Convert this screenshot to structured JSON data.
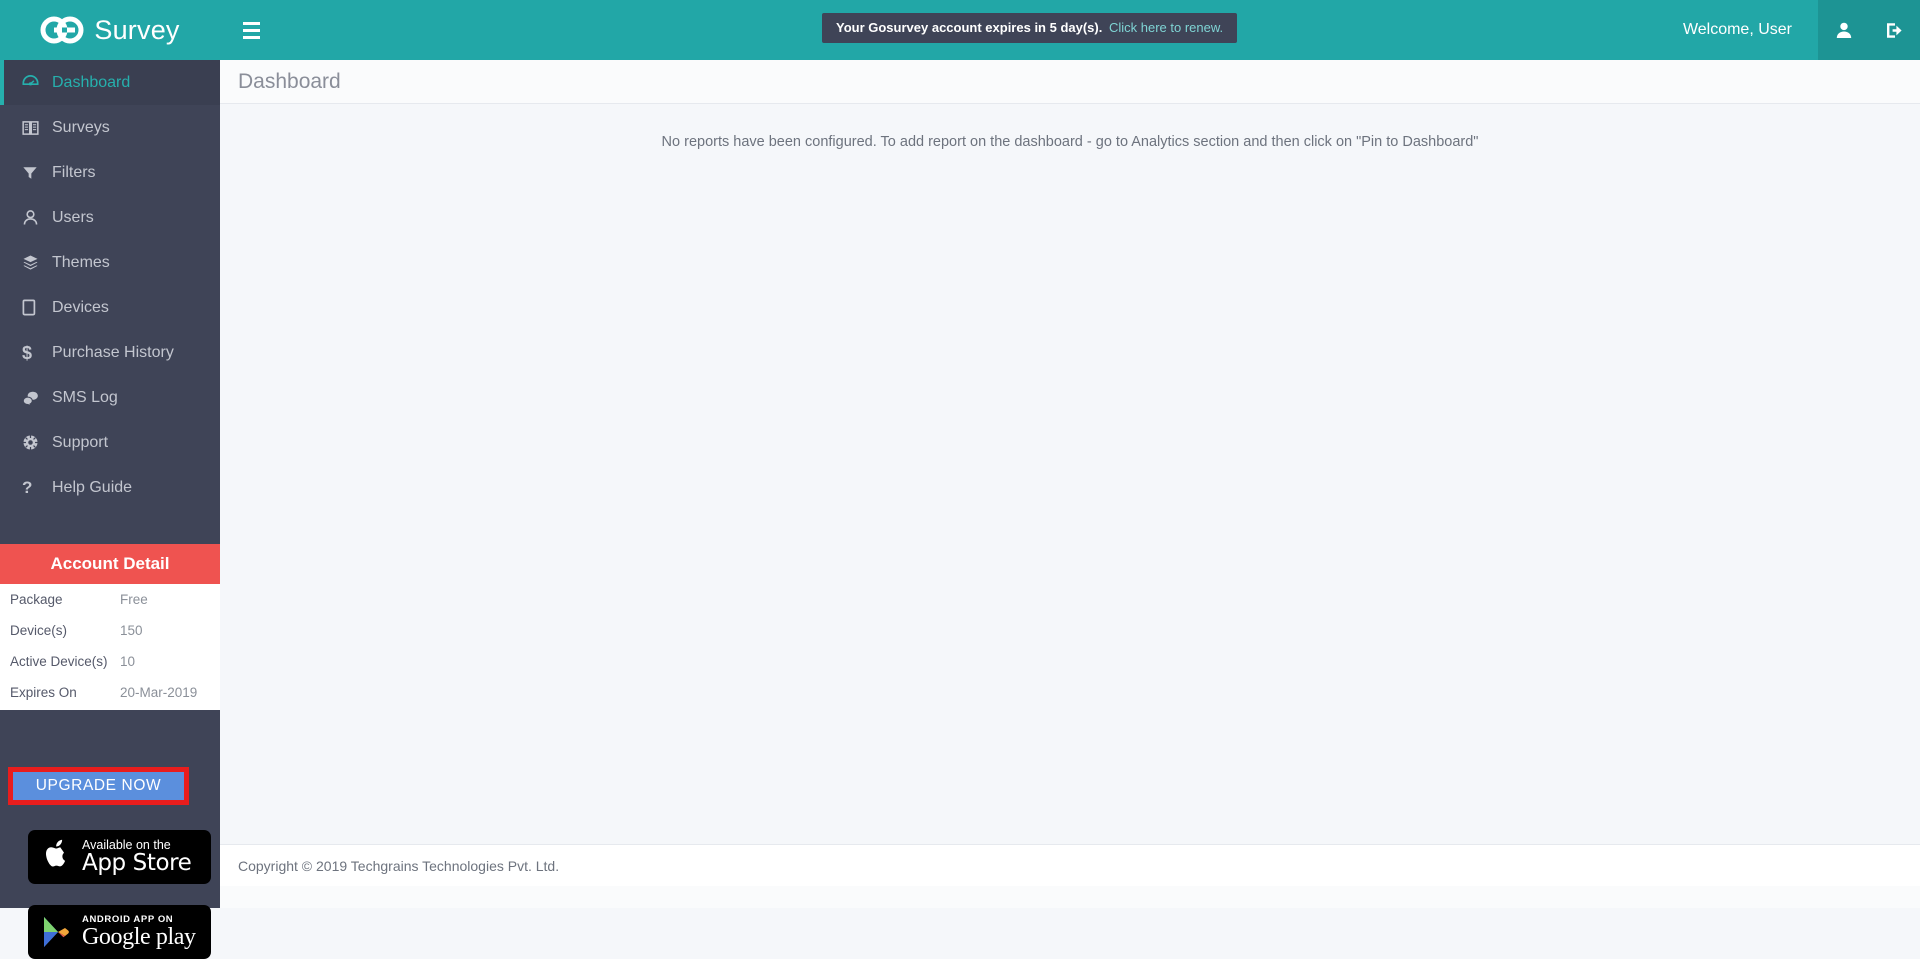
{
  "brand": {
    "text": "Survey",
    "mark_icon": "go-logo-icon"
  },
  "header": {
    "menu_toggle_icon": "hamburger-icon",
    "banner": {
      "message": "Your Gosurvey account expires in 5 day(s).",
      "link": "Click here to renew."
    },
    "welcome": "Welcome, User",
    "profile_icon": "user-icon",
    "logout_icon": "logout-icon",
    "bg_color": "#22a7a7"
  },
  "sidebar": {
    "bg_color": "#3f4457",
    "active_color": "#26b0ad",
    "items": [
      {
        "label": "Dashboard",
        "icon": "dashboard-gauge-icon",
        "active": true
      },
      {
        "label": "Surveys",
        "icon": "book-icon",
        "active": false
      },
      {
        "label": "Filters",
        "icon": "funnel-icon",
        "active": false
      },
      {
        "label": "Users",
        "icon": "user-outline-icon",
        "active": false
      },
      {
        "label": "Themes",
        "icon": "layers-icon",
        "active": false
      },
      {
        "label": "Devices",
        "icon": "tablet-icon",
        "active": false
      },
      {
        "label": "Purchase History",
        "icon": "dollar-icon",
        "active": false
      },
      {
        "label": "SMS Log",
        "icon": "chat-bubbles-icon",
        "active": false
      },
      {
        "label": "Support",
        "icon": "globe-icon",
        "active": false
      },
      {
        "label": "Help Guide",
        "icon": "question-mark-icon",
        "active": false
      }
    ]
  },
  "account_detail": {
    "title": "Account Detail",
    "title_bg": "#ef5350",
    "rows": [
      {
        "key": "Package",
        "value": "Free"
      },
      {
        "key": "Device(s)",
        "value": "150"
      },
      {
        "key": "Active Device(s)",
        "value": "10"
      },
      {
        "key": "Expires On",
        "value": "20-Mar-2019"
      }
    ],
    "upgrade_label": "UPGRADE NOW",
    "upgrade_bg": "#5b8fdd",
    "highlight_color": "#e81d1d"
  },
  "store_badges": [
    {
      "small": "Available on the",
      "big": "App Store",
      "icon": "apple-logo-icon"
    },
    {
      "small": "ANDROID APP ON",
      "big": "Google play",
      "icon": "google-play-icon"
    }
  ],
  "annotation": {
    "arrow_icon": "left-arrow-icon",
    "color": "#e81d1d"
  },
  "main": {
    "page_title": "Dashboard",
    "empty_state": "No reports have been configured. To add report on the dashboard - go to Analytics section and then click on \"Pin to Dashboard\"",
    "footer": "Copyright © 2019 Techgrains Technologies Pvt. Ltd."
  }
}
